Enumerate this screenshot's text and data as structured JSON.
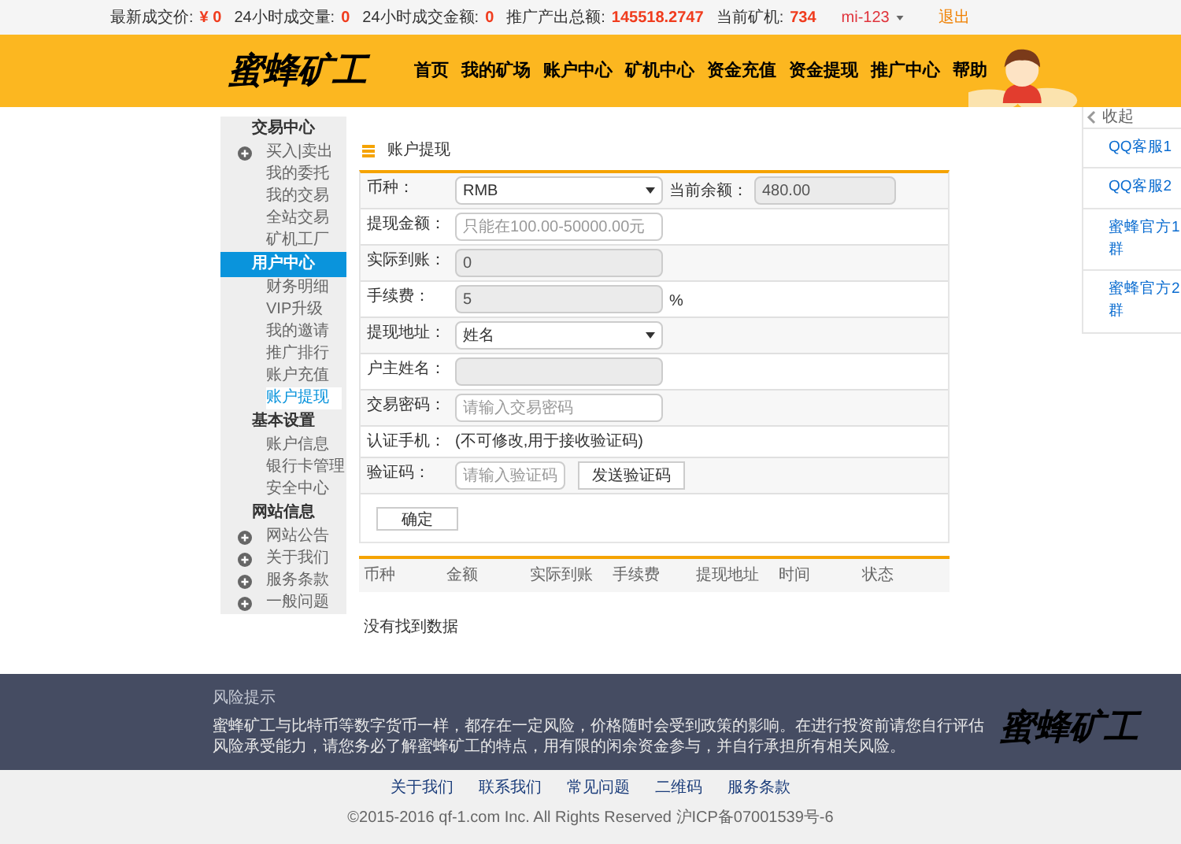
{
  "top_bar": {
    "stats": [
      {
        "label": "最新成交价:",
        "value": "¥ 0"
      },
      {
        "label": "24小时成交量:",
        "value": "0"
      },
      {
        "label": "24小时成交金额:",
        "value": "0"
      },
      {
        "label": "推广产出总额:",
        "value": "145518.2747"
      },
      {
        "label": "当前矿机:",
        "value": "734"
      }
    ],
    "user": "mi-123",
    "logout": "退出"
  },
  "header": {
    "logo": "蜜蜂矿工",
    "nav": [
      "首页",
      "我的矿场",
      "账户中心",
      "矿机中心",
      "资金充值",
      "资金提现",
      "推广中心",
      "帮助"
    ]
  },
  "right_panel": {
    "toggle": "收起",
    "links": [
      "QQ客服1",
      "QQ客服2",
      "蜜蜂官方1群",
      "蜜蜂官方2群"
    ]
  },
  "sidebar": [
    {
      "title": "交易中心",
      "selected": false,
      "items": [
        {
          "label": "买入|卖出",
          "icon": true,
          "selected": false
        },
        {
          "label": "我的委托",
          "icon": false,
          "selected": false
        },
        {
          "label": "我的交易",
          "icon": false,
          "selected": false
        },
        {
          "label": "全站交易",
          "icon": false,
          "selected": false
        },
        {
          "label": "矿机工厂",
          "icon": false,
          "selected": false
        }
      ]
    },
    {
      "title": "用户中心",
      "selected": true,
      "items": [
        {
          "label": "财务明细",
          "icon": false,
          "selected": false
        },
        {
          "label": "VIP升级",
          "icon": false,
          "selected": false
        },
        {
          "label": "我的邀请",
          "icon": false,
          "selected": false
        },
        {
          "label": "推广排行",
          "icon": false,
          "selected": false
        },
        {
          "label": "账户充值",
          "icon": false,
          "selected": false
        },
        {
          "label": "账户提现",
          "icon": false,
          "selected": true
        }
      ]
    },
    {
      "title": "基本设置",
      "selected": false,
      "items": [
        {
          "label": "账户信息",
          "icon": false,
          "selected": false
        },
        {
          "label": "银行卡管理",
          "icon": false,
          "selected": false
        },
        {
          "label": "安全中心",
          "icon": false,
          "selected": false
        }
      ]
    },
    {
      "title": "网站信息",
      "selected": false,
      "items": [
        {
          "label": "网站公告",
          "icon": true,
          "selected": false
        },
        {
          "label": "关于我们",
          "icon": true,
          "selected": false
        },
        {
          "label": "服务条款",
          "icon": true,
          "selected": false
        },
        {
          "label": "一般问题",
          "icon": true,
          "selected": false
        }
      ]
    }
  ],
  "form": {
    "title": "账户提现",
    "rows": [
      {
        "kind": "select",
        "label": "币种：",
        "value": "RMB",
        "extra_label": "当前余额：",
        "extra_value": "480.00"
      },
      {
        "kind": "input",
        "label": "提现金额：",
        "placeholder": "只能在100.00-50000.00元",
        "disabled": false
      },
      {
        "kind": "input",
        "label": "实际到账：",
        "value": "0",
        "disabled": true
      },
      {
        "kind": "input",
        "label": "手续费：",
        "value": "5",
        "disabled": true,
        "suffix": "%"
      },
      {
        "kind": "select",
        "label": "提现地址：",
        "value": "姓名"
      },
      {
        "kind": "input",
        "label": "户主姓名：",
        "disabled": true
      },
      {
        "kind": "input",
        "label": "交易密码：",
        "placeholder": "请输入交易密码",
        "disabled": false
      },
      {
        "kind": "text",
        "label": "认证手机：",
        "text": "(不可修改,用于接收验证码)"
      },
      {
        "kind": "code",
        "label": "验证码：",
        "placeholder": "请输入验证码",
        "button": "发送验证码"
      }
    ],
    "submit": "确定"
  },
  "table": {
    "columns": [
      "币种",
      "金额",
      "实际到账",
      "手续费",
      "提现地址",
      "时间",
      "状态"
    ],
    "empty": "没有找到数据"
  },
  "footer": {
    "title": "风险提示",
    "text": "蜜蜂矿工与比特币等数字货币一样，都存在一定风险，价格随时会受到政策的影响。在进行投资前请您自行评估风险承受能力，请您务必了解蜜蜂矿工的特点，用有限的闲余资金参与，并自行承担所有相关风险。",
    "logo": "蜜蜂矿工",
    "links": [
      "关于我们",
      "联系我们",
      "常见问题",
      "二维码",
      "服务条款"
    ],
    "copyright": "©2015-2016 qf-1.com Inc. All Rights Reserved 沪ICP备07001539号-6"
  }
}
